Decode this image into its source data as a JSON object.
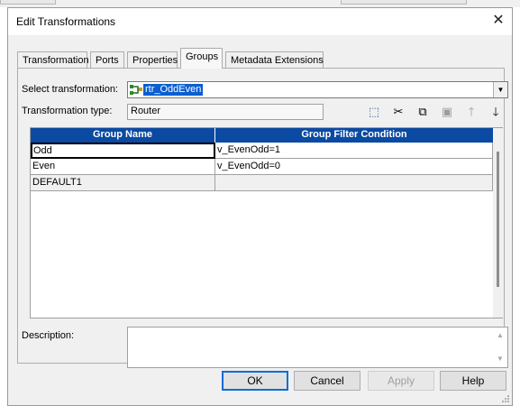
{
  "window": {
    "title": "Edit Transformations",
    "close_glyph": "✕"
  },
  "tabs": [
    {
      "label": "Transformation",
      "active": false
    },
    {
      "label": "Ports",
      "active": false
    },
    {
      "label": "Properties",
      "active": false
    },
    {
      "label": "Groups",
      "active": true
    },
    {
      "label": "Metadata Extensions",
      "active": false
    }
  ],
  "form": {
    "select_label": "Select transformation:",
    "select_value": "rtr_OddEven",
    "select_icon": "router-transformation-icon",
    "type_label": "Transformation type:",
    "type_value": "Router"
  },
  "toolbar": [
    {
      "name": "new-group-icon",
      "glyph": "⬚",
      "enabled": true
    },
    {
      "name": "cut-icon",
      "glyph": "✂",
      "enabled": true
    },
    {
      "name": "copy-icon",
      "glyph": "⧉",
      "enabled": true
    },
    {
      "name": "paste-icon",
      "glyph": "▣",
      "enabled": false
    },
    {
      "name": "move-up-icon",
      "glyph": "🡑",
      "enabled": false
    },
    {
      "name": "move-down-icon",
      "glyph": "🡓",
      "enabled": true
    }
  ],
  "grid": {
    "columns": [
      "Group Name",
      "Group Filter Condition"
    ],
    "rows": [
      {
        "name": "Odd",
        "condition": "v_EvenOdd=1",
        "selected": true,
        "default": false
      },
      {
        "name": "Even",
        "condition": "v_EvenOdd=0",
        "selected": false,
        "default": false
      },
      {
        "name": "DEFAULT1",
        "condition": "",
        "selected": false,
        "default": true
      }
    ]
  },
  "description": {
    "label": "Description:",
    "value": ""
  },
  "buttons": [
    {
      "label": "OK",
      "enabled": true,
      "default": true
    },
    {
      "label": "Cancel",
      "enabled": true,
      "default": false
    },
    {
      "label": "Apply",
      "enabled": false,
      "default": false
    },
    {
      "label": "Help",
      "enabled": true,
      "default": false
    }
  ],
  "colors": {
    "header_blue": "#0b4aa2",
    "selection_blue": "#0a5fd0",
    "default_button_border": "#0a6cd6"
  }
}
